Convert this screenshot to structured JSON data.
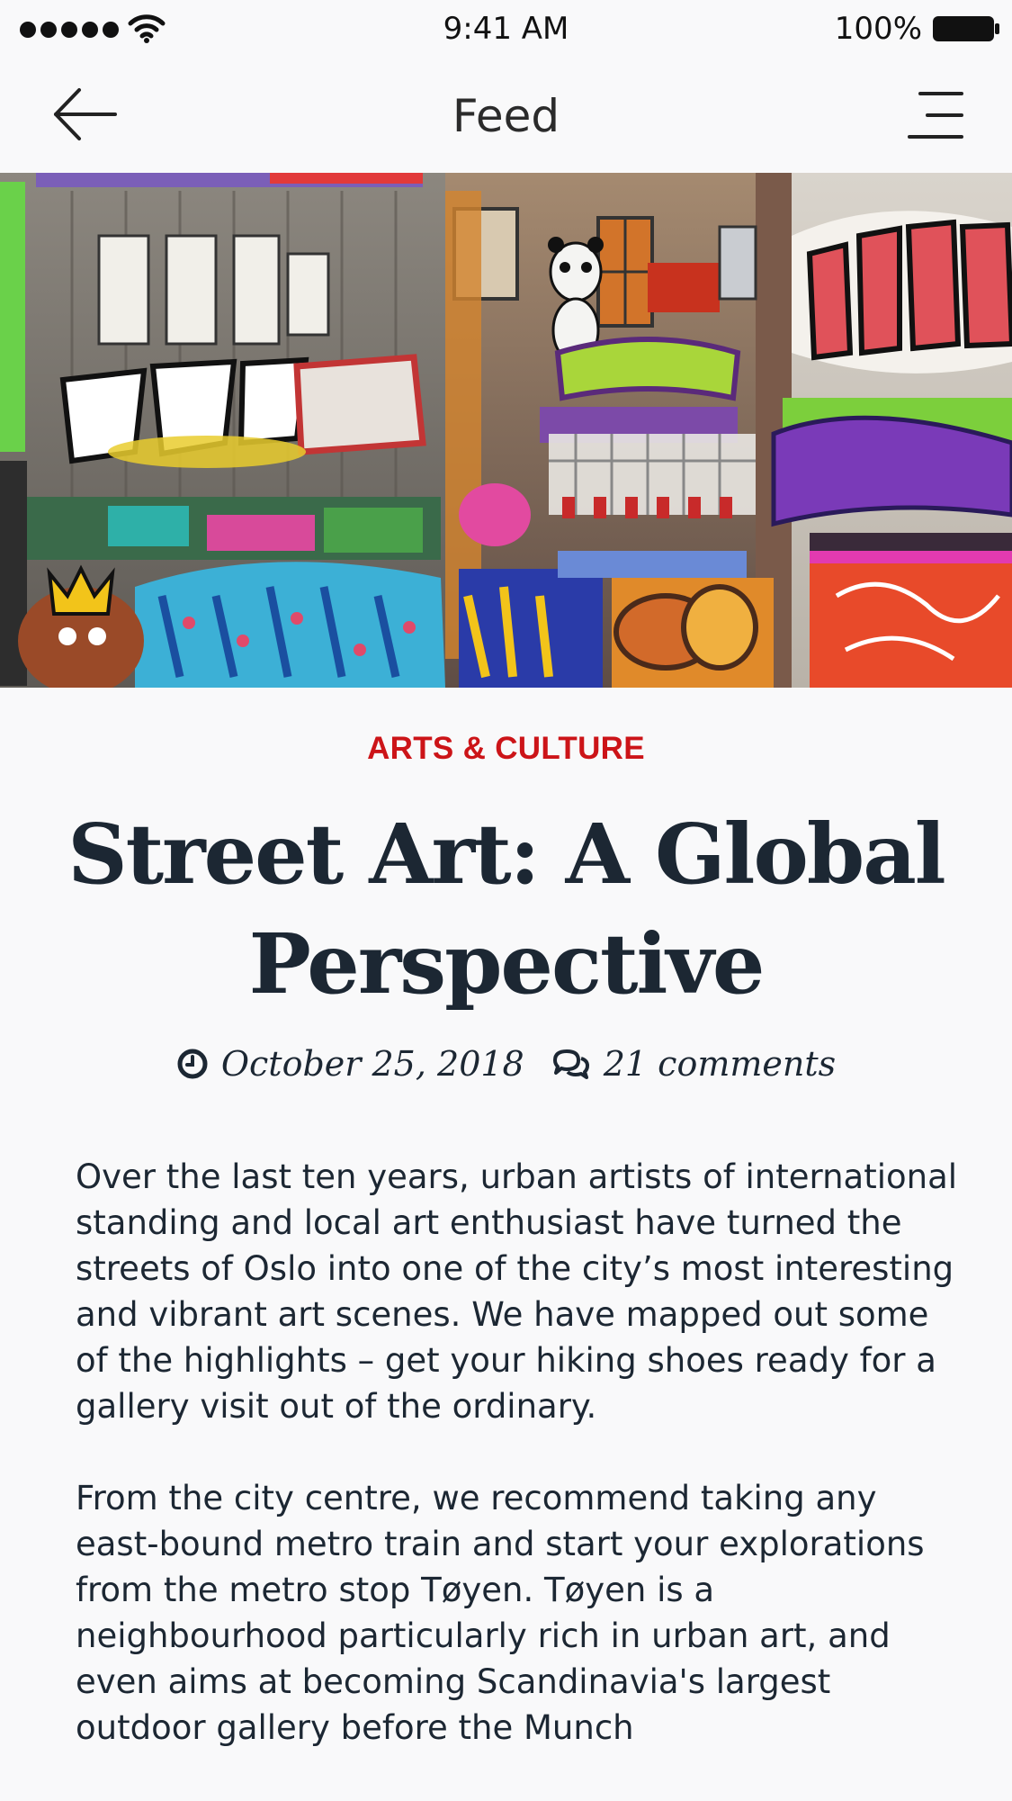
{
  "status_bar": {
    "time": "9:41 AM",
    "battery": "100%",
    "icons": [
      "signal-icon",
      "wifi-icon",
      "battery-icon"
    ]
  },
  "nav": {
    "title": "Feed",
    "back_icon": "back-arrow-icon",
    "menu_icon": "menu-icon"
  },
  "hero": {
    "image": "graffiti-street-art-photo"
  },
  "article": {
    "category": "ARTS & CULTURE",
    "title": "Street Art: A Global Perspective",
    "date": "October 25, 2018",
    "comments": "21 comments",
    "paragraphs": [
      "Over the last ten years, urban artists of international standing and local art enthusiast have turned the streets of Oslo into one of the city’s most interesting and vibrant art scenes. We have mapped out some of the highlights – get your hiking shoes ready for a gallery visit out of the ordinary.",
      "From the city centre, we recommend taking any east-bound metro train and start your explorations from the metro stop Tøyen. Tøyen is a neighbourhood particularly rich in urban art, and even aims at becoming Scandinavia's largest outdoor gallery before the Munch"
    ]
  },
  "colors": {
    "category": "#cc1418",
    "title": "#1c2733",
    "background": "#f9f9fa"
  }
}
